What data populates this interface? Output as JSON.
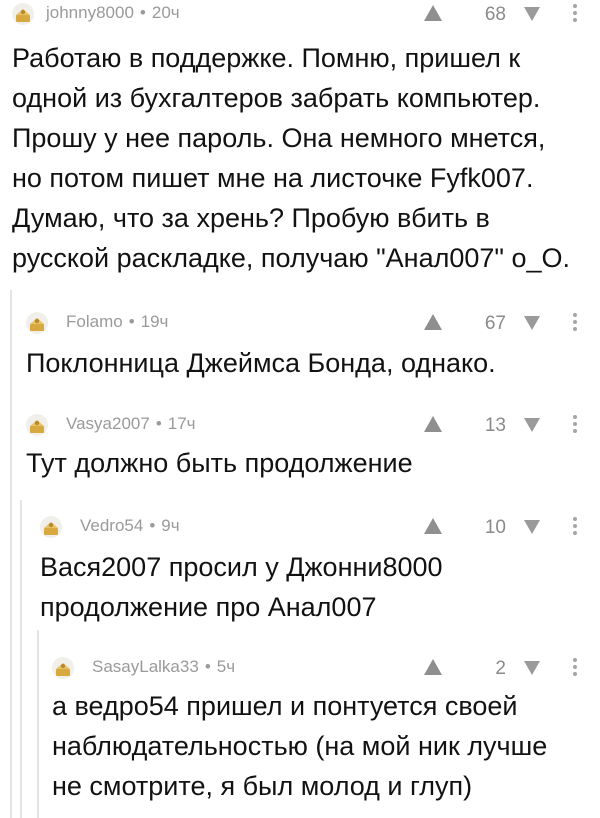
{
  "comments": [
    {
      "author": "johnny8000",
      "time": "20ч",
      "votes": "68",
      "text": "Работаю в поддержке. Помню, пришел к\nодной из бухгалтеров забрать компьютер.\nПрошу у нее пароль. Она немного мнется,\nно потом пишет мне на листочке Fyfk007.\nДумаю, что за хрень? Пробую вбить в\nрусской раскладке, получаю \"Анал007\" о_О."
    },
    {
      "author": "Folamo",
      "time": "19ч",
      "votes": "67",
      "text": "Поклонница Джеймса Бонда, однако."
    },
    {
      "author": "Vasya2007",
      "time": "17ч",
      "votes": "13",
      "text": "Тут должно быть продолжение"
    },
    {
      "author": "Vedro54",
      "time": "9ч",
      "votes": "10",
      "text": "Вася2007 просил у Джонни8000\nпродолжение про Анал007"
    },
    {
      "author": "SasayLalka33",
      "time": "5ч",
      "votes": "2",
      "text": "а ведро54 пришел и понтуется своей\nнаблюдательностью (на мой ник лучше\nне смотрите, я был молод и глуп)"
    }
  ],
  "separator": "•",
  "colors": {
    "meta": "#9a9a9a",
    "thread_line": "#e4e4e4",
    "vote_arrow": "#8f8f8f",
    "text": "#121212"
  },
  "icons": {
    "avatar": "default-avatar-icon",
    "upvote": "upvote-arrow-icon",
    "downvote": "downvote-arrow-icon",
    "more": "more-vertical-icon"
  }
}
